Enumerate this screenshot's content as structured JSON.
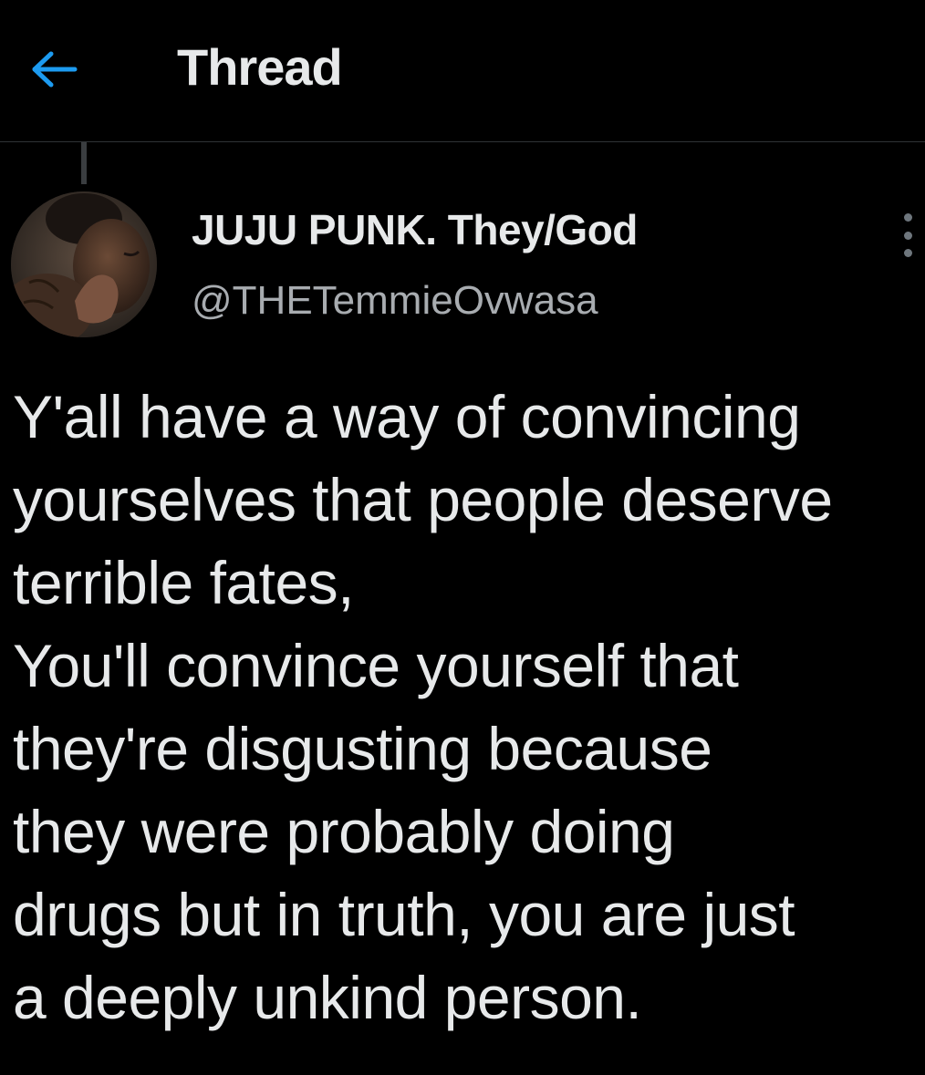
{
  "header": {
    "title": "Thread",
    "back_icon": "arrow-left-icon",
    "back_color": "#1d9bf0"
  },
  "tweet": {
    "author_name": "JUJU PUNK. They/God",
    "author_handle": "@THETemmieOvwasa",
    "more_icon": "more-vertical-icon",
    "text": "Y'all have a way of convincing\nyourselves that people deserve\nterrible fates,\nYou'll convince yourself that\nthey're disgusting because\nthey were probably doing\ndrugs but in truth, you are just\na deeply unkind person."
  },
  "colors": {
    "background": "#000000",
    "text_primary": "#e7e9ea",
    "text_secondary": "#a8acb0",
    "divider": "#2f3336",
    "accent": "#1d9bf0"
  }
}
